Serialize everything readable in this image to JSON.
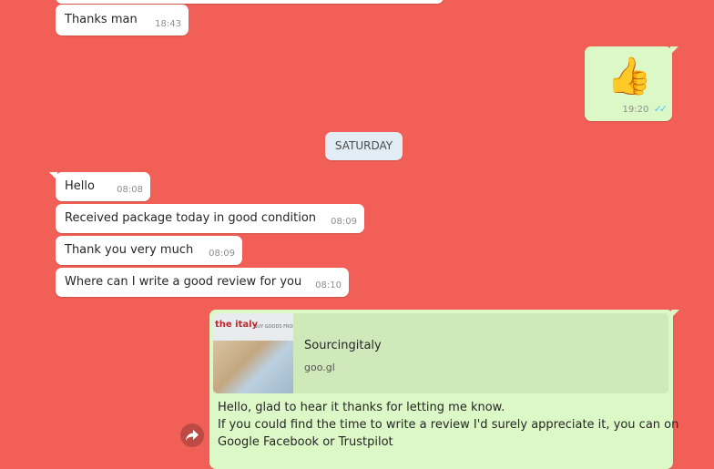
{
  "messages": {
    "m1": {
      "text": "Thanks man",
      "time": "18:43"
    },
    "m2": {
      "time": "19:20",
      "emoji": "👍"
    },
    "date_divider": "SATURDAY",
    "m3": {
      "text": "Hello",
      "time": "08:08"
    },
    "m4": {
      "text": "Received package today in good condition",
      "time": "08:09"
    },
    "m5": {
      "text": "Thank you very much",
      "time": "08:09"
    },
    "m6": {
      "text": "Where can I write a good review for you",
      "time": "08:10"
    },
    "m7": {
      "link_title": "Sourcingitaly",
      "link_domain": "goo.gl",
      "thumb_logo": "the italy",
      "thumb_tagline": "BUY GOODS FROM ITALY",
      "lines": [
        "Hello, glad to hear it thanks for letting me know.",
        "If you could find the time to write a review I'd surely appreciate it, you can on",
        "Google Facebook or Trustpilot"
      ]
    }
  },
  "icons": {
    "read_receipt": "double-check-icon",
    "forward": "forward-icon"
  },
  "colors": {
    "background": "#f25f56",
    "incoming": "#ffffff",
    "outgoing": "#dcf8c6",
    "ticks": "#4fc3f7"
  }
}
